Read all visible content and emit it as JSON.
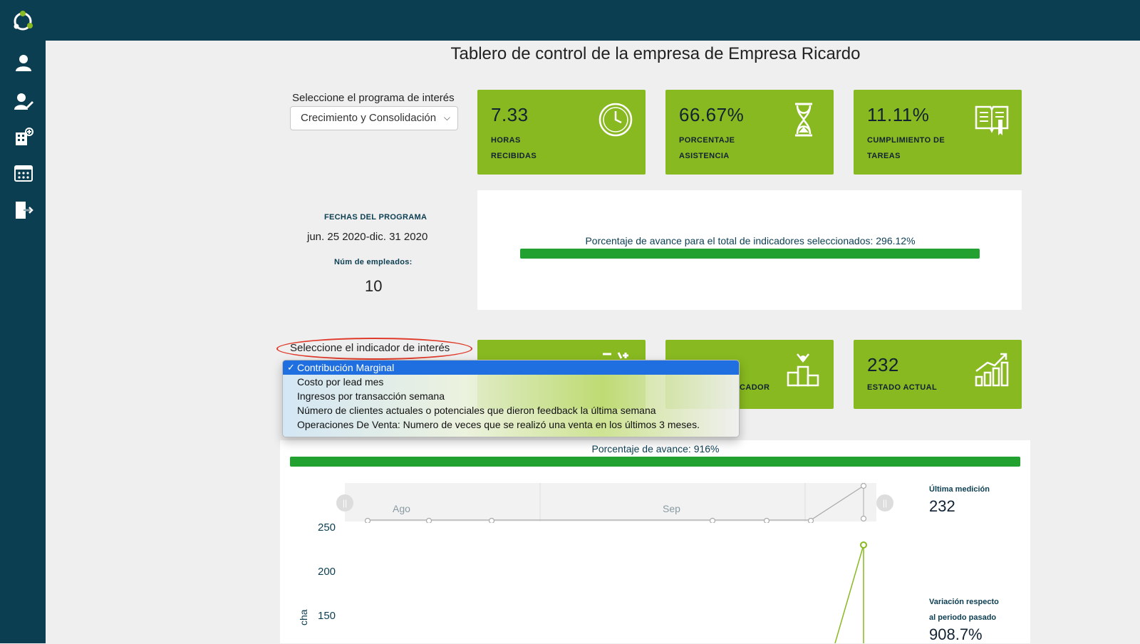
{
  "page_title": "Tablero de control de la empresa de Empresa Ricardo",
  "program": {
    "label": "Seleccione el programa de interés",
    "selected": "Crecimiento y Consolidación"
  },
  "summary_cards": [
    {
      "value": "7.33",
      "line1": "HORAS",
      "line2": "RECIBIDAS",
      "icon": "clock-icon"
    },
    {
      "value": "66.67%",
      "line1": "PORCENTAJE",
      "line2": "ASISTENCIA",
      "icon": "hourglass-icon"
    },
    {
      "value": "11.11%",
      "line1": "CUMPLIMIENTO DE",
      "line2": "TAREAS",
      "icon": "book-icon"
    }
  ],
  "program_info": {
    "dates_label": "FECHAS DEL PROGRAMA",
    "dates_value": "jun. 25 2020-dic. 31 2020",
    "employees_label": "Núm de empleados:",
    "employees_value": "10"
  },
  "overall_progress": {
    "text": "Porcentaje de avance para el total de indicadores seleccionados: 296.12%",
    "percent": 296.12
  },
  "indicator": {
    "label": "Seleccione el indicador de interés",
    "options": [
      "Contribución Marginal",
      "Costo por lead mes",
      "Ingresos por transacción semana",
      "Número de clientes actuales o potenciales que dieron feedback la última semana",
      "Operaciones De Venta: Numero de veces que se realizó una venta en los últimos 3 meses."
    ],
    "selected_index": 0
  },
  "indicator_cards": [
    {
      "value": "",
      "label": "",
      "icon": "target-icon"
    },
    {
      "value": "",
      "label": "CADOR",
      "icon": "podium-icon"
    },
    {
      "value": "232",
      "label": "ESTADO ACTUAL",
      "icon": "growth-chart-icon"
    }
  ],
  "indicator_progress": {
    "text": "Porcentaje de avance: 916%",
    "percent": 916
  },
  "timeline": {
    "months": [
      "Ago",
      "Sep"
    ]
  },
  "chart_data": {
    "type": "line",
    "y_ticks": [
      "250",
      "200",
      "150"
    ],
    "ylabel_fragment": "cha",
    "ylim": [
      100,
      260
    ],
    "points": [
      {
        "x": "last",
        "y": 232
      }
    ]
  },
  "side_info": {
    "last_label": "Última medición",
    "last_value": "232",
    "variation_label_1": "Variación respecto",
    "variation_label_2": "al periodo pasado",
    "variation_value": "908.7%"
  },
  "colors": {
    "sidebar": "#0c3e52",
    "card_green": "#88b920",
    "progress_green": "#22a030",
    "highlight_blue": "#1f6fe0",
    "annotation_red": "#e03a2a"
  }
}
